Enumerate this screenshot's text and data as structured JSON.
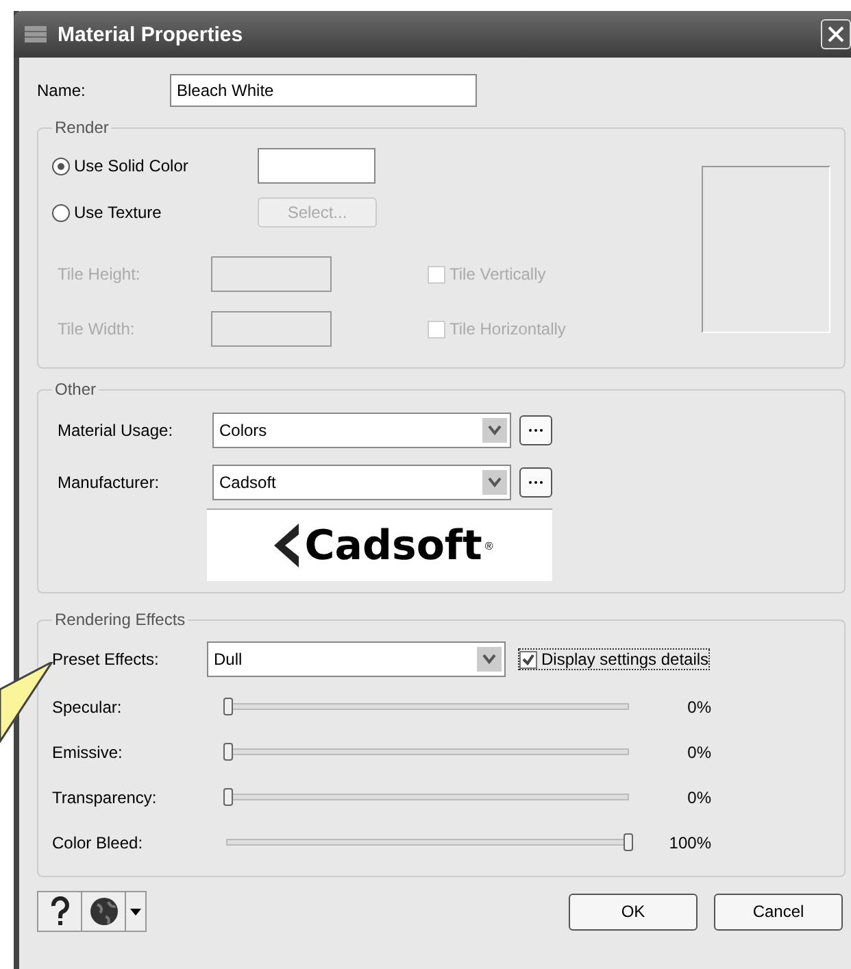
{
  "window": {
    "title": "Material Properties"
  },
  "name": {
    "label": "Name:",
    "value": "Bleach White"
  },
  "render": {
    "title": "Render",
    "options": [
      {
        "label": "Use Solid Color",
        "selected": true
      },
      {
        "label": "Use Texture",
        "selected": false
      }
    ],
    "select_button": {
      "label": "Select...",
      "disabled": true
    },
    "tile_fields": [
      {
        "label": "Tile Height:",
        "disabled": true
      },
      {
        "label": "Tile Width:",
        "disabled": true
      }
    ],
    "tile_checks": [
      {
        "label": "Tile Vertically",
        "checked": false,
        "disabled": true
      },
      {
        "label": "Tile Horizontally",
        "checked": false,
        "disabled": true
      }
    ]
  },
  "other": {
    "title": "Other",
    "fields": [
      {
        "label": "Material Usage:",
        "value": "Colors"
      },
      {
        "label": "Manufacturer:",
        "value": "Cadsoft"
      }
    ],
    "logo_text": "Cadsoft",
    "logo_mark": "®"
  },
  "effects": {
    "title": "Rendering Effects",
    "preset": {
      "label": "Preset Effects:",
      "value": "Dull"
    },
    "details": {
      "label": "Display settings details",
      "checked": true
    },
    "sliders": [
      {
        "name": "Specular:",
        "level": 0,
        "reading": "0%"
      },
      {
        "name": "Emissive:",
        "level": 0,
        "reading": "0%"
      },
      {
        "name": "Transparency:",
        "level": 0,
        "reading": "0%"
      },
      {
        "name": "Color Bleed:",
        "level": 1,
        "reading": "100%"
      }
    ]
  },
  "buttons": [
    "OK",
    "Cancel"
  ]
}
